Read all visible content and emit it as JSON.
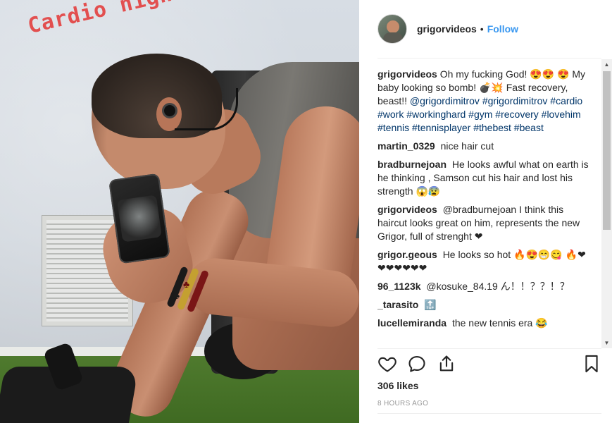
{
  "story_overlay": {
    "text": "Cardio night!"
  },
  "header": {
    "username": "grigorvideos",
    "separator": "•",
    "follow_label": "Follow"
  },
  "caption": {
    "username": "grigorvideos",
    "text_part1": "Oh my fucking God! 😍😍",
    "text_part2": "😍 My baby looking so bomb! 💣💥 Fast recovery, beast!!",
    "hashtags": "@grigordimitrov #grigordimitrov #cardio #work #workinghard #gym #recovery #lovehim #tennis #tennisplayer #thebest #beast"
  },
  "comments": [
    {
      "username": "martin_0329",
      "text": "nice hair cut"
    },
    {
      "username": "bradburnejoan",
      "text": "He looks awful what on earth is he thinking , Samson cut his hair and lost his strength 😱😰"
    },
    {
      "username": "grigorvideos",
      "text": "@bradburnejoan I think this haircut looks great on him, represents the new Grigor, full of strenght ❤"
    },
    {
      "username": "grigor.geous",
      "text": "He looks so hot 🔥😍😁😋 🔥❤❤❤❤❤❤❤"
    },
    {
      "username": "96_1123k",
      "text": "@kosuke_84.19 ん！！？？！？"
    },
    {
      "username": "_tarasito",
      "text": "🔝"
    },
    {
      "username": "lucellemiranda",
      "text": "the new tennis era 😂"
    }
  ],
  "actions": {
    "like_icon": "heart-outline-icon",
    "comment_icon": "speech-bubble-icon",
    "share_icon": "share-upload-icon",
    "save_icon": "bookmark-icon"
  },
  "likes_text": "306 likes",
  "timestamp": "8 HOURS AGO",
  "colors": {
    "follow": "#3897f0",
    "hashtag": "#003569",
    "overlay_text": "#e24f4f"
  }
}
